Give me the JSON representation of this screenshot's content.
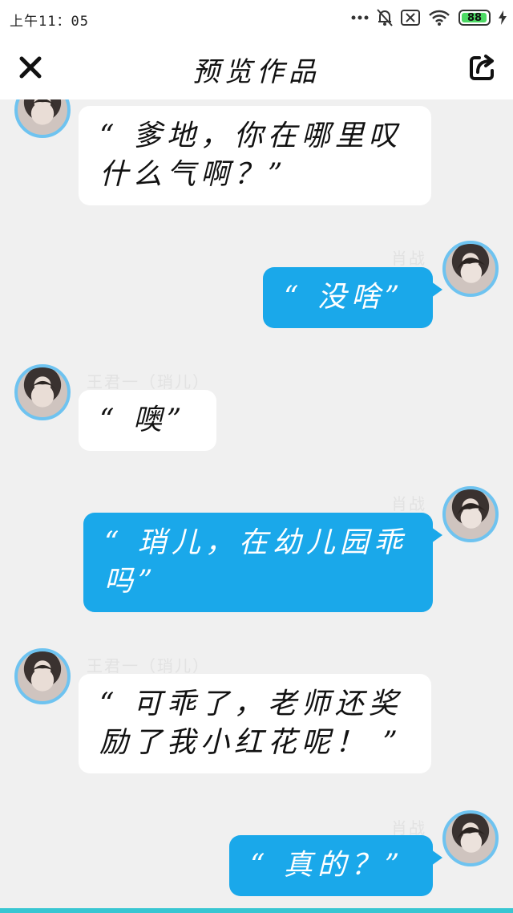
{
  "status": {
    "time": "上午11：05",
    "battery": "88"
  },
  "nav": {
    "title": "预览作品"
  },
  "colors": {
    "accent": "#1aa8ea",
    "avatar_border": "#6ec3f0",
    "background": "#f0f0f0"
  },
  "messages": [
    {
      "side": "left",
      "sender": "",
      "text": "“ 爹地，你在哪里叹什么气啊？”"
    },
    {
      "side": "right",
      "sender": "肖战",
      "text": "“ 没啥”"
    },
    {
      "side": "left",
      "sender": "王君一（琑儿）",
      "text": "“ 噢”"
    },
    {
      "side": "right",
      "sender": "肖战",
      "text": "“ 琑儿，在幼儿园乖吗”"
    },
    {
      "side": "left",
      "sender": "王君一（琑儿）",
      "text": "“ 可乖了，老师还奖励了我小红花呢！ ”"
    },
    {
      "side": "right",
      "sender": "肖战",
      "text": "“ 真的？”"
    }
  ]
}
